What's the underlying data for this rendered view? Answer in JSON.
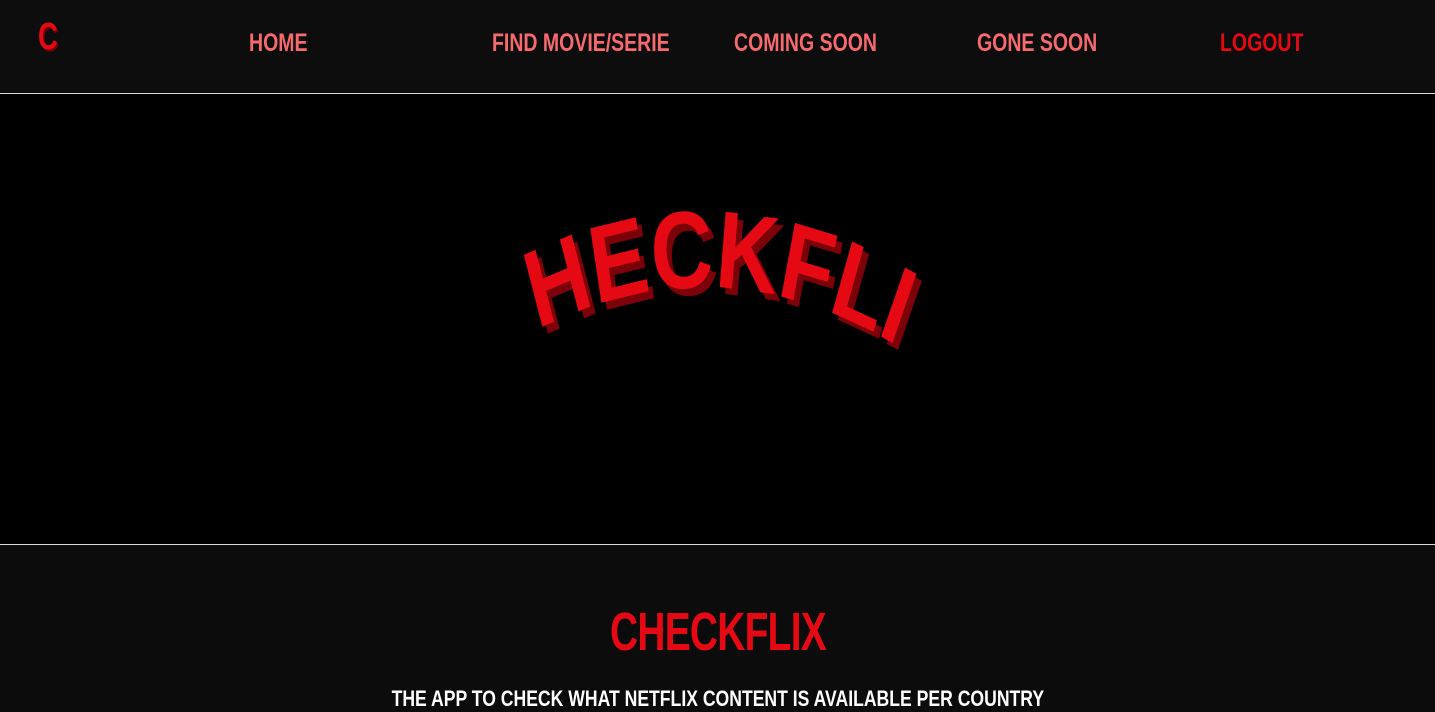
{
  "header": {
    "logo_letter": "C",
    "nav": {
      "home": "HOME",
      "find": "FIND MOVIE/SERIE",
      "coming_soon": "COMING SOON",
      "gone_soon": "GONE SOON",
      "logout": "LOGOUT"
    }
  },
  "hero": {
    "logo_text": "CHECKFLIX"
  },
  "main": {
    "title": "CHECKFLIX",
    "tagline": "THE APP TO CHECK WHAT NETFLIX CONTENT IS AVAILABLE PER COUNTRY"
  },
  "colors": {
    "brand_red": "#e50914",
    "nav_pink": "#f56a6e",
    "shadow_red": "#7a0208",
    "background": "#0c0c0c"
  }
}
